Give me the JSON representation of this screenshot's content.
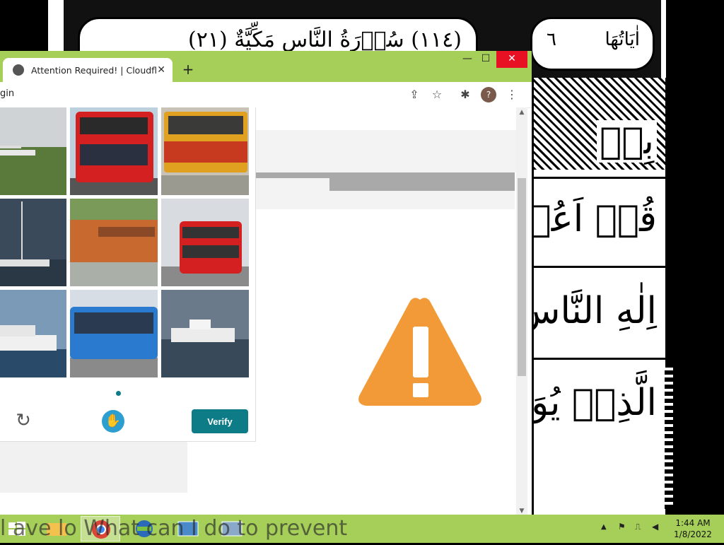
{
  "browser": {
    "tab_title": "Attention Required! | Cloudflare",
    "tab_close": "✕",
    "new_tab": "+",
    "url_fragment": "gin",
    "profile_initial": "?",
    "window_controls": {
      "minimize": "—",
      "maximize": "☐",
      "close": "✕"
    }
  },
  "captcha": {
    "verify_label": "Verify",
    "refresh_icon": "↻",
    "tiles": [
      {
        "subject": "airplane",
        "selected": false
      },
      {
        "subject": "red double-decker bus",
        "selected": false
      },
      {
        "subject": "orange bus",
        "selected": false
      },
      {
        "subject": "sailboat",
        "selected": true
      },
      {
        "subject": "train",
        "selected": false
      },
      {
        "subject": "red double-decker bus",
        "selected": false
      },
      {
        "subject": "yacht",
        "selected": true
      },
      {
        "subject": "blue bus",
        "selected": false
      },
      {
        "subject": "speedboat",
        "selected": true
      }
    ]
  },
  "background": {
    "header_verse_number": "٦",
    "header_left_text": "(١١٤) سُوۡرَةُ النَّاسِ مَكِّيَّةٌ (٢١)",
    "header_right_text": "اٰيَاتُهَا",
    "lines": [
      "بِسۡ",
      "قُلۡ اَعُوۡذُ",
      "اِلٰهِ النَّاسِ",
      "الَّذِىۡ يُوَ"
    ]
  },
  "taskbar": {
    "overlay_text": "l ave lo        What can I do to prevent",
    "clock_time": "1:44 AM",
    "clock_date": "1/8/2022"
  },
  "colors": {
    "accent_green": "#a6cf59",
    "captcha_teal": "#0e7c86",
    "warning_orange": "#f29a37",
    "close_red": "#e81123"
  }
}
